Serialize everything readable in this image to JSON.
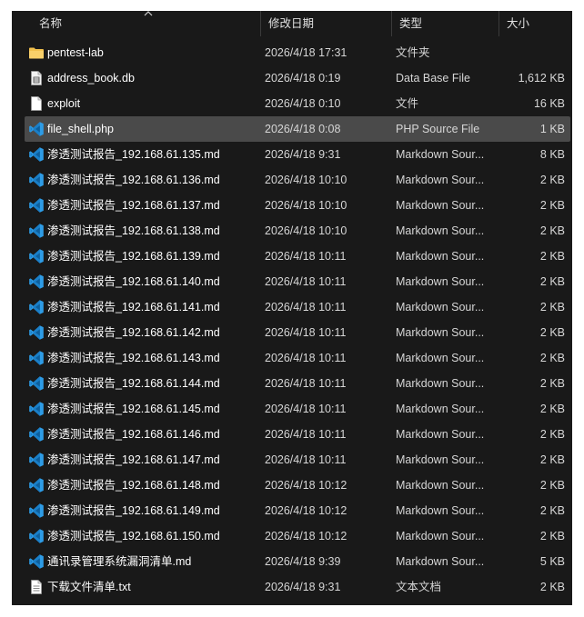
{
  "columns": {
    "name": "名称",
    "date": "修改日期",
    "type": "类型",
    "size": "大小"
  },
  "colors": {
    "folder": "#f2c14e",
    "vscode": "#2e9ce6",
    "selected_row": "#4a4a4a",
    "background": "#191919"
  },
  "files": [
    {
      "name": "pentest-lab",
      "date": "2026/4/18 17:31",
      "type": "文件夹",
      "size": "",
      "icon": "folder-icon"
    },
    {
      "name": "address_book.db",
      "date": "2026/4/18 0:19",
      "type": "Data Base File",
      "size": "1,612 KB",
      "icon": "database-file-icon"
    },
    {
      "name": "exploit",
      "date": "2026/4/18 0:10",
      "type": "文件",
      "size": "16 KB",
      "icon": "blank-file-icon"
    },
    {
      "name": "file_shell.php",
      "date": "2026/4/18 0:08",
      "type": "PHP Source File",
      "size": "1 KB",
      "icon": "vscode-icon",
      "selected": true
    },
    {
      "name": "渗透测试报告_192.168.61.135.md",
      "date": "2026/4/18 9:31",
      "type": "Markdown Sour...",
      "size": "8 KB",
      "icon": "vscode-icon"
    },
    {
      "name": "渗透测试报告_192.168.61.136.md",
      "date": "2026/4/18 10:10",
      "type": "Markdown Sour...",
      "size": "2 KB",
      "icon": "vscode-icon"
    },
    {
      "name": "渗透测试报告_192.168.61.137.md",
      "date": "2026/4/18 10:10",
      "type": "Markdown Sour...",
      "size": "2 KB",
      "icon": "vscode-icon"
    },
    {
      "name": "渗透测试报告_192.168.61.138.md",
      "date": "2026/4/18 10:10",
      "type": "Markdown Sour...",
      "size": "2 KB",
      "icon": "vscode-icon"
    },
    {
      "name": "渗透测试报告_192.168.61.139.md",
      "date": "2026/4/18 10:11",
      "type": "Markdown Sour...",
      "size": "2 KB",
      "icon": "vscode-icon"
    },
    {
      "name": "渗透测试报告_192.168.61.140.md",
      "date": "2026/4/18 10:11",
      "type": "Markdown Sour...",
      "size": "2 KB",
      "icon": "vscode-icon"
    },
    {
      "name": "渗透测试报告_192.168.61.141.md",
      "date": "2026/4/18 10:11",
      "type": "Markdown Sour...",
      "size": "2 KB",
      "icon": "vscode-icon"
    },
    {
      "name": "渗透测试报告_192.168.61.142.md",
      "date": "2026/4/18 10:11",
      "type": "Markdown Sour...",
      "size": "2 KB",
      "icon": "vscode-icon"
    },
    {
      "name": "渗透测试报告_192.168.61.143.md",
      "date": "2026/4/18 10:11",
      "type": "Markdown Sour...",
      "size": "2 KB",
      "icon": "vscode-icon"
    },
    {
      "name": "渗透测试报告_192.168.61.144.md",
      "date": "2026/4/18 10:11",
      "type": "Markdown Sour...",
      "size": "2 KB",
      "icon": "vscode-icon"
    },
    {
      "name": "渗透测试报告_192.168.61.145.md",
      "date": "2026/4/18 10:11",
      "type": "Markdown Sour...",
      "size": "2 KB",
      "icon": "vscode-icon"
    },
    {
      "name": "渗透测试报告_192.168.61.146.md",
      "date": "2026/4/18 10:11",
      "type": "Markdown Sour...",
      "size": "2 KB",
      "icon": "vscode-icon"
    },
    {
      "name": "渗透测试报告_192.168.61.147.md",
      "date": "2026/4/18 10:11",
      "type": "Markdown Sour...",
      "size": "2 KB",
      "icon": "vscode-icon"
    },
    {
      "name": "渗透测试报告_192.168.61.148.md",
      "date": "2026/4/18 10:12",
      "type": "Markdown Sour...",
      "size": "2 KB",
      "icon": "vscode-icon"
    },
    {
      "name": "渗透测试报告_192.168.61.149.md",
      "date": "2026/4/18 10:12",
      "type": "Markdown Sour...",
      "size": "2 KB",
      "icon": "vscode-icon"
    },
    {
      "name": "渗透测试报告_192.168.61.150.md",
      "date": "2026/4/18 10:12",
      "type": "Markdown Sour...",
      "size": "2 KB",
      "icon": "vscode-icon"
    },
    {
      "name": "通讯录管理系统漏洞清单.md",
      "date": "2026/4/18 9:39",
      "type": "Markdown Sour...",
      "size": "5 KB",
      "icon": "vscode-icon"
    },
    {
      "name": "下载文件清单.txt",
      "date": "2026/4/18 9:31",
      "type": "文本文档",
      "size": "2 KB",
      "icon": "text-file-icon"
    }
  ]
}
